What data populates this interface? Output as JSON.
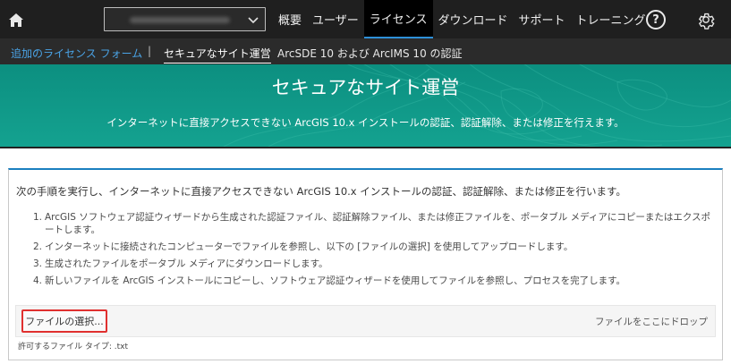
{
  "nav": {
    "items": [
      {
        "label": "概要",
        "active": false
      },
      {
        "label": "ユーザー",
        "active": false
      },
      {
        "label": "ライセンス",
        "active": true
      },
      {
        "label": "ダウンロード",
        "active": false
      },
      {
        "label": "サポート",
        "active": false
      },
      {
        "label": "トレーニング",
        "active": false
      }
    ],
    "help": "?"
  },
  "subnav": {
    "add_form": "追加のライセンス フォーム",
    "separator": "|",
    "secure_site": "セキュアなサイト運営",
    "arcsde": "ArcSDE 10 および ArcIMS 10 の認証"
  },
  "banner": {
    "title": "セキュアなサイト運営",
    "description": "インターネットに直接アクセスできない ArcGIS 10.x インストールの認証、認証解除、または修正を行えます。",
    "color": "#12998a"
  },
  "card": {
    "intro": "次の手順を実行し、インターネットに直接アクセスできない ArcGIS 10.x インストールの認証、認証解除、または修正を行います。",
    "steps": [
      {
        "num": "1.",
        "text": "ArcGIS ソフトウェア認証ウィザードから生成された認証ファイル、認証解除ファイル、または修正ファイルを、ポータブル メディアにコピーまたはエクスポートします。"
      },
      {
        "num": "2.",
        "text": "インターネットに接続されたコンピューターでファイルを参照し、以下の [ファイルの選択] を使用してアップロードします。"
      },
      {
        "num": "3.",
        "text": "生成されたファイルをポータブル メディアにダウンロードします。"
      },
      {
        "num": "4.",
        "text": "新しいファイルを ArcGIS インストールにコピーし、ソフトウェア認証ウィザードを使用してファイルを参照し、プロセスを完了します。"
      }
    ],
    "choose_file": "ファイルの選択...",
    "drop_here": "ファイルをここにドロップ",
    "allowed_types": "許可するファイル タイプ: .txt"
  }
}
